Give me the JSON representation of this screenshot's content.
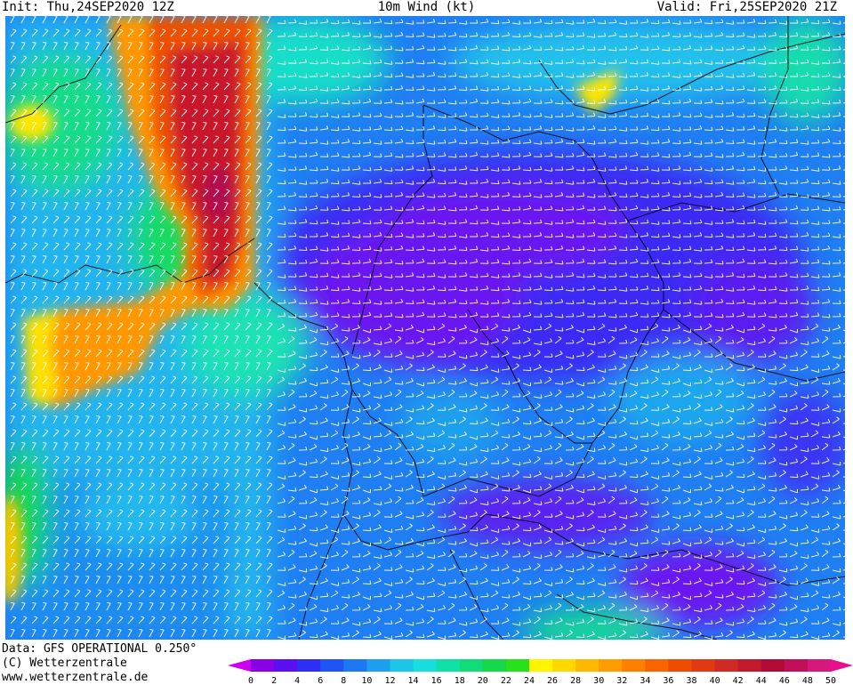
{
  "header": {
    "init": "Init: Thu,24SEP2020 12Z",
    "title": "10m Wind (kt)",
    "valid": "Valid: Fri,25SEP2020 21Z"
  },
  "footer": {
    "data_source": "Data: GFS OPERATIONAL 0.250°",
    "copyright": "(C) Wetterzentrale",
    "website": "www.wetterzentrale.de"
  },
  "colorbar": {
    "labels": [
      "0",
      "2",
      "4",
      "6",
      "8",
      "10",
      "12",
      "14",
      "16",
      "18",
      "20",
      "22",
      "24",
      "26",
      "28",
      "30",
      "32",
      "34",
      "36",
      "38",
      "40",
      "42",
      "44",
      "46",
      "48",
      "50"
    ],
    "colors": [
      "#8a00e6",
      "#5a10f0",
      "#2f2ef5",
      "#1f55f5",
      "#1d79f2",
      "#1fa0ee",
      "#1ec6ea",
      "#18dede",
      "#10e0a8",
      "#12dc78",
      "#16d84a",
      "#28e01e",
      "#fff500",
      "#ffd800",
      "#ffba00",
      "#ff9c00",
      "#ff8000",
      "#f86400",
      "#ee4c00",
      "#e03a14",
      "#d02a24",
      "#c01a2c",
      "#b00c38",
      "#c0105a",
      "#d4187e"
    ]
  },
  "map": {
    "region": "Central Europe",
    "max_wind_kt": 44,
    "min_wind_kt": 0
  }
}
